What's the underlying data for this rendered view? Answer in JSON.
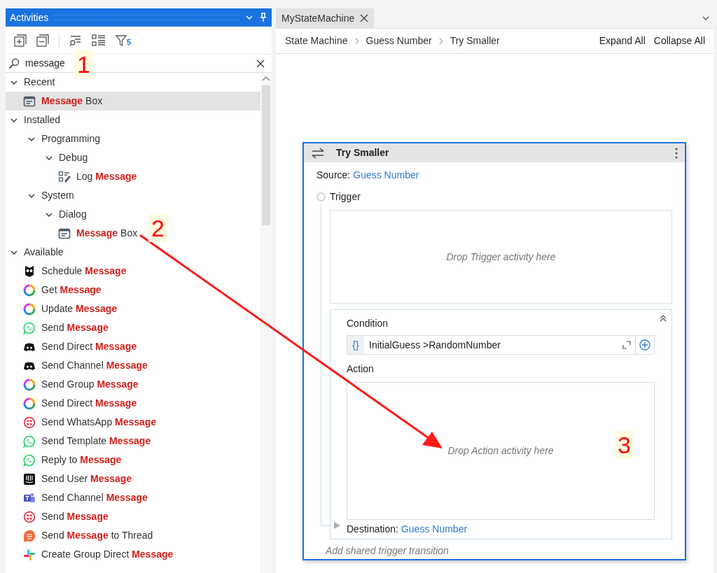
{
  "activities_panel": {
    "title": "Activities",
    "filter_count": "5",
    "search": {
      "value": "message"
    },
    "tree": [
      {
        "label": "Recent",
        "expanded": true,
        "children": [
          {
            "label": "**Message** Box",
            "kind": "dialog",
            "selected": true
          }
        ]
      },
      {
        "label": "Installed",
        "expanded": true,
        "children": [
          {
            "label": "Programming",
            "expanded": true,
            "children": [
              {
                "label": "Debug",
                "expanded": true,
                "children": [
                  {
                    "label": "Log **Message**",
                    "kind": "log",
                    "selected": false
                  }
                ]
              }
            ]
          },
          {
            "label": "System",
            "expanded": true,
            "children": [
              {
                "label": "Dialog",
                "expanded": true,
                "children": [
                  {
                    "label": "**Message** Box",
                    "kind": "dialog",
                    "selected": false
                  }
                ]
              }
            ]
          }
        ]
      },
      {
        "label": "Available",
        "expanded": true,
        "children": [
          {
            "label": "Schedule **Message**",
            "kind": "owl",
            "selected": false
          },
          {
            "label": "Get **Message**",
            "kind": "ring",
            "selected": false
          },
          {
            "label": "Update **Message**",
            "kind": "ring",
            "selected": false
          },
          {
            "label": "Send **Message**",
            "kind": "whatsapp",
            "selected": false
          },
          {
            "label": "Send Direct **Message**",
            "kind": "discord",
            "selected": false
          },
          {
            "label": "Send Channel **Message**",
            "kind": "discord",
            "selected": false
          },
          {
            "label": "Send Group **Message**",
            "kind": "ring",
            "selected": false
          },
          {
            "label": "Send Direct **Message**",
            "kind": "ring",
            "selected": false
          },
          {
            "label": "Send WhatsApp **Message**",
            "kind": "twilio",
            "selected": false
          },
          {
            "label": "Send Template **Message**",
            "kind": "whatsapp",
            "selected": false
          },
          {
            "label": "Reply to **Message**",
            "kind": "whatsapp",
            "selected": false
          },
          {
            "label": "Send User **Message**",
            "kind": "intercom",
            "selected": false
          },
          {
            "label": "Send Channel **Message**",
            "kind": "teams",
            "selected": false
          },
          {
            "label": "Send **Message**",
            "kind": "twilio",
            "selected": false
          },
          {
            "label": "Send **Message** to Thread",
            "kind": "thread",
            "selected": false
          },
          {
            "label": "Create Group Direct **Message**",
            "kind": "slack",
            "selected": false
          }
        ]
      }
    ]
  },
  "document_tab": {
    "title": "MyStateMachine",
    "selected": true
  },
  "breadcrumb": [
    "State Machine",
    "Guess Number",
    "Try Smaller"
  ],
  "toolbar_buttons": [
    "Expand All",
    "Collapse All"
  ],
  "transition": {
    "title": "Try Smaller",
    "source_label": "Source:",
    "source": "Guess Number",
    "trigger_label": "Trigger",
    "trigger_selected": false,
    "trigger_placeholder": "Drop Trigger activity here",
    "condition_label": "Condition",
    "condition_icon": "{}",
    "condition": "InitialGuess >RandomNumber",
    "action_label": "Action",
    "action_placeholder": "Drop Action activity here",
    "destination_label": "Destination:",
    "destination": "Guess Number",
    "add_link": "Add shared trigger transition"
  },
  "annotations": [
    {
      "label": "1"
    },
    {
      "label": "2"
    },
    {
      "label": "3"
    }
  ]
}
